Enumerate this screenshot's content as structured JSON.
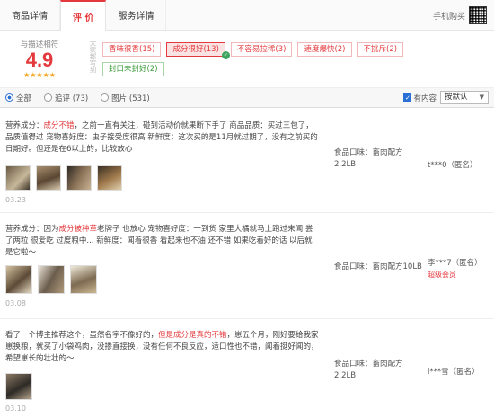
{
  "tabs": [
    {
      "label": "商品详情"
    },
    {
      "label": "评 价"
    },
    {
      "label": "服务详情"
    }
  ],
  "mobile_buy": "手机购买",
  "summary": {
    "score_label": "与描述相符",
    "score": "4.9",
    "stars": "★★★★★",
    "side_label": "大家都写到"
  },
  "tags": [
    {
      "text": "香味很香(15)"
    },
    {
      "text": "成分很好(13)"
    },
    {
      "text": "不容易拉稀(3)"
    },
    {
      "text": "速度爆快(2)"
    },
    {
      "text": "不挑斥(2)"
    },
    {
      "text": "封口未封好(2)"
    }
  ],
  "filter": {
    "all": "全部",
    "append": "追评 (73)",
    "pictures": "图片 (531)",
    "has_content": "有内容",
    "sort": "按默认"
  },
  "reviews": [
    {
      "pre": "营养成分：",
      "hl": "成分不错",
      "post": "，之前一直有关注，碰到活动价就果断下手了 商品品质：买过三包了，品质值得过 宠物喜好度：虫子接受度很高 新鲜度：这次买的是11月就过期了，没有之前买的日期好。但还是在6以上的，比较放心",
      "date": "03.23",
      "flavor_label": "食品口味：畜肉配方",
      "flavor_weight": "2.2LB",
      "user": "t***0（匿名）",
      "vip": ""
    },
    {
      "pre": "营养成分：因为",
      "hl": "成分被种草",
      "post": "老牌子 也放心 宠物喜好度：一到货 家里大橘就马上跑过来闻 尝了两粒 很爱吃 过度粮中... 新鲜度：闻着很香 看起来也不油 还不错 如果吃着好的话 以后就是它啦～",
      "date": "03.08",
      "flavor_label": "食品口味：畜肉配方10LB",
      "flavor_weight": "",
      "user": "李***7（匿名）",
      "vip": "超级会员"
    },
    {
      "pre": "看了一个博主推荐这个，虽然名字不像好的，",
      "hl": "但是成分是真的不错",
      "post": "，崽五个月，刚好要给我家崽换粮，就买了小袋鸡肉，没掺直接换，没有任何不良反应，适口性也不错，闻着挺好闻的，希望崽长的壮壮的～",
      "date": "03.10",
      "flavor_label": "食品口味：畜肉配方",
      "flavor_weight": "2.2LB",
      "user": "l***雪（匿名）",
      "vip": ""
    }
  ],
  "colors": {
    "accent": "#e4393c",
    "star": "#f5a623",
    "green": "#3a9b3a"
  }
}
